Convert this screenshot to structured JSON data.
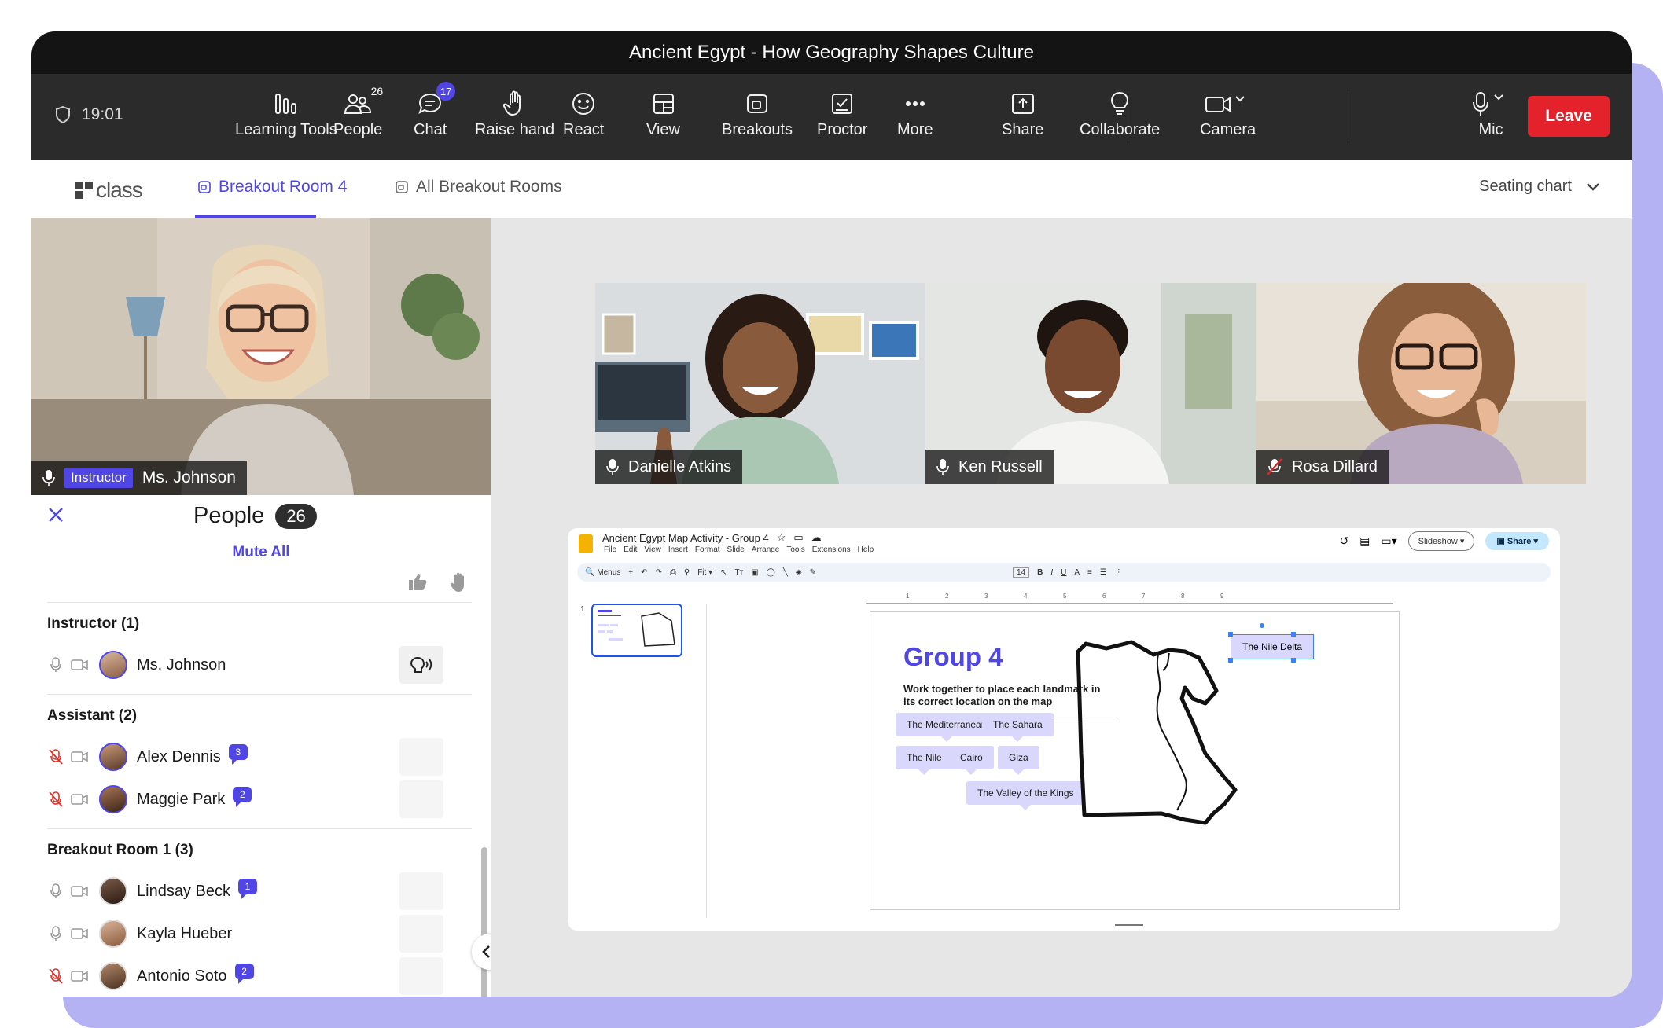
{
  "window": {
    "title": "Ancient Egypt - How Geography Shapes Culture"
  },
  "toolbar": {
    "timer": "19:01",
    "tools": [
      {
        "label": "Learning Tools",
        "icon": "learning-tools-icon"
      },
      {
        "label": "People",
        "icon": "people-icon",
        "badge": "26"
      },
      {
        "label": "Chat",
        "icon": "chat-icon",
        "badge": "17"
      },
      {
        "label": "Raise hand",
        "icon": "raise-hand-icon"
      },
      {
        "label": "React",
        "icon": "react-icon"
      },
      {
        "label": "View",
        "icon": "view-icon"
      },
      {
        "label": "Breakouts",
        "icon": "breakouts-icon"
      },
      {
        "label": "Proctor",
        "icon": "proctor-icon"
      },
      {
        "label": "More",
        "icon": "more-icon"
      },
      {
        "label": "Share",
        "icon": "share-icon"
      },
      {
        "label": "Collaborate",
        "icon": "collaborate-icon"
      },
      {
        "label": "Camera",
        "icon": "camera-icon"
      },
      {
        "label": "Mic",
        "icon": "mic-icon"
      }
    ],
    "leave_label": "Leave",
    "accent": "#e3222b"
  },
  "tabs": {
    "logo": "class",
    "active": "Breakout Room 4",
    "other": "All Breakout Rooms",
    "seating": "Seating chart",
    "accent": "#4f46e5"
  },
  "instructor_video": {
    "tag": "Instructor",
    "name": "Ms. Johnson"
  },
  "tiles": [
    {
      "name": "Danielle Atkins",
      "muted": false
    },
    {
      "name": "Ken Russell",
      "muted": false
    },
    {
      "name": "Rosa Dillard",
      "muted": true
    }
  ],
  "people": {
    "title": "People",
    "count": "26",
    "mute_all": "Mute All",
    "groups": [
      {
        "heading": "Instructor (1)",
        "members": [
          {
            "name": "Ms. Johnson",
            "muted": false,
            "badge": ""
          }
        ]
      },
      {
        "heading": "Assistant (2)",
        "members": [
          {
            "name": "Alex Dennis",
            "muted": true,
            "badge": "3"
          },
          {
            "name": "Maggie Park",
            "muted": true,
            "badge": "2"
          }
        ]
      },
      {
        "heading": "Breakout Room 1 (3)",
        "members": [
          {
            "name": "Lindsay Beck",
            "muted": false,
            "badge": "1"
          },
          {
            "name": "Kayla Hueber",
            "muted": false,
            "badge": ""
          },
          {
            "name": "Antonio Soto",
            "muted": true,
            "badge": "2"
          }
        ]
      }
    ]
  },
  "slides": {
    "doc_title": "Ancient Egypt Map Activity - Group 4",
    "menu": [
      "File",
      "Edit",
      "View",
      "Insert",
      "Format",
      "Slide",
      "Arrange",
      "Tools",
      "Extensions",
      "Help"
    ],
    "slideshow_label": "Slideshow",
    "share_label": "Share",
    "search_placeholder": "Menus",
    "zoom": "Fit",
    "font_size": "14",
    "slide_number": "1",
    "ruler_marks": [
      "1",
      "2",
      "3",
      "4",
      "5",
      "6",
      "7",
      "8",
      "9"
    ],
    "canvas": {
      "heading": "Group 4",
      "subtitle": "Work together to place each landmark in its correct location on the map",
      "chips": [
        "The Mediterranean",
        "The Sahara",
        "The Nile",
        "Cairo",
        "Giza",
        "The Valley of the Kings"
      ],
      "selected_label": "The Nile Delta"
    }
  }
}
